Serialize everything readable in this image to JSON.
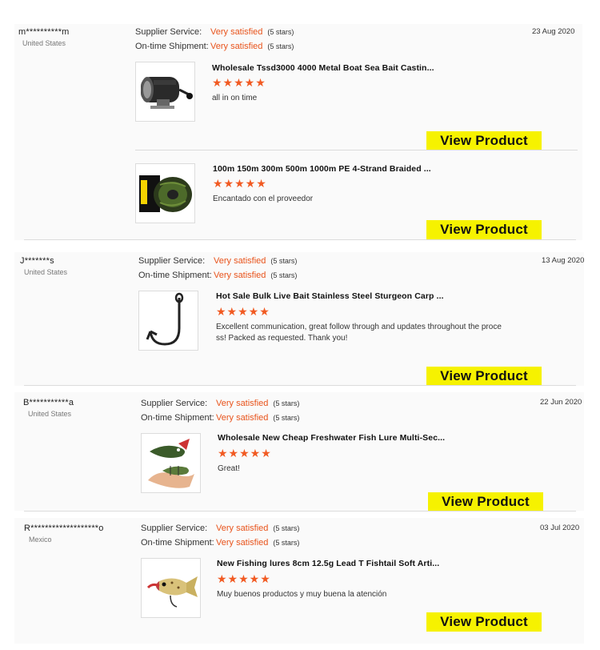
{
  "labels": {
    "supplier_service": "Supplier Service:",
    "ontime_shipment": "On-time Shipment:",
    "view_product": "View Product",
    "star_glyphs": "★★★★★"
  },
  "reviews": [
    {
      "buyer": "m**********m",
      "country": "United States",
      "date": "23 Aug 2020",
      "supplier_service": "Very satisfied",
      "supplier_stars": "(5 stars)",
      "ontime_shipment": "Very satisfied",
      "ontime_stars": "(5 stars)",
      "products": [
        {
          "title": "Wholesale Tssd3000 4000 Metal Boat Sea Bait Castin...",
          "rating": 5,
          "comment": "all in on time",
          "thumb_icon": "fishing-reel-icon"
        },
        {
          "title": "100m 150m 300m 500m 1000m PE 4-Strand Braided ...",
          "rating": 5,
          "comment": "Encantado con el proveedor",
          "thumb_icon": "braided-line-spool-icon"
        }
      ]
    },
    {
      "buyer": "J*******s",
      "country": "United States",
      "date": "13 Aug 2020",
      "supplier_service": "Very satisfied",
      "supplier_stars": "(5 stars)",
      "ontime_shipment": "Very satisfied",
      "ontime_stars": "(5 stars)",
      "products": [
        {
          "title": "Hot Sale Bulk Live Bait Stainless Steel Sturgeon Carp ...",
          "rating": 5,
          "comment": "Excellent communication, great follow through and updates throughout the proce ss! Packed as requested. Thank you!",
          "thumb_icon": "fish-hook-icon"
        }
      ]
    },
    {
      "buyer": "B***********a",
      "country": "United States",
      "date": "22 Jun 2020",
      "supplier_service": "Very satisfied",
      "supplier_stars": "(5 stars)",
      "ontime_shipment": "Very satisfied",
      "ontime_stars": "(5 stars)",
      "products": [
        {
          "title": "Wholesale New Cheap Freshwater Fish Lure Multi-Sec...",
          "rating": 5,
          "comment": "Great!",
          "thumb_icon": "multi-section-lure-icon"
        }
      ]
    },
    {
      "buyer": "R*******************o",
      "country": "Mexico",
      "date": "03 Jul 2020",
      "supplier_service": "Very satisfied",
      "supplier_stars": "(5 stars)",
      "ontime_shipment": "Very satisfied",
      "ontime_stars": "(5 stars)",
      "products": [
        {
          "title": "New Fishing lures 8cm 12.5g Lead T Fishtail Soft Arti...",
          "rating": 5,
          "comment": "Muy buenos productos y muy buena la atención",
          "thumb_icon": "soft-lure-icon"
        }
      ]
    }
  ],
  "colors": {
    "accent_orange": "#e8531b",
    "star_orange": "#f15a22",
    "button_yellow": "#f6f200",
    "divider": "#dcdcdc"
  }
}
